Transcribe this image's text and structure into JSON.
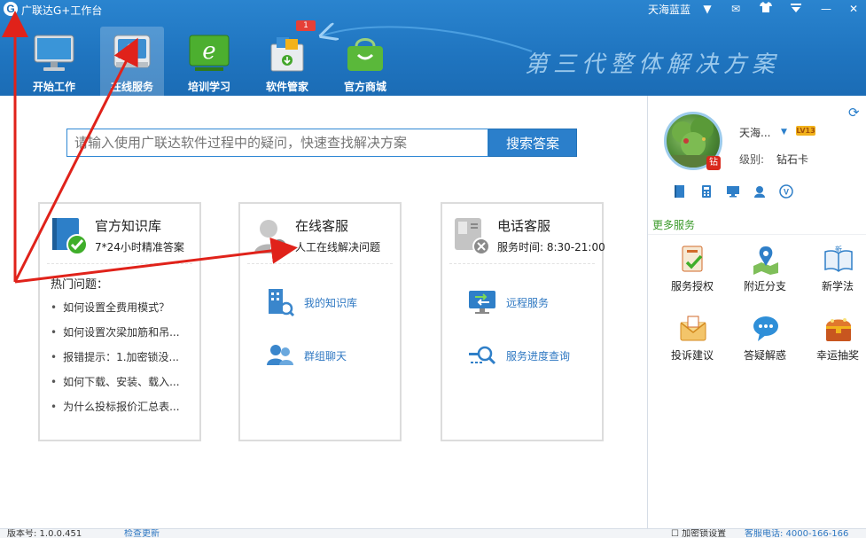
{
  "app": {
    "logo_letter": "G",
    "title": "广联达G+工作台",
    "user_name": "天海蓝蓝",
    "slogan": "第三代整体解决方案"
  },
  "nav": {
    "tabs": [
      {
        "label": "开始工作",
        "icon": "monitor-icon"
      },
      {
        "label": "在线服务",
        "icon": "glodon-service-icon",
        "active": true
      },
      {
        "label": "培训学习",
        "icon": "training-screen-icon"
      },
      {
        "label": "软件管家",
        "icon": "software-box-icon",
        "badge": "1"
      },
      {
        "label": "官方商城",
        "icon": "shopping-bag-icon"
      }
    ]
  },
  "search": {
    "placeholder": "请输入使用广联达软件过程中的疑问，快速查找解决方案",
    "button_label": "搜索答案"
  },
  "cards": {
    "knowledge": {
      "title": "官方知识库",
      "subtitle": "7*24小时精准答案",
      "hot_title": "热门问题：",
      "hot_items": [
        "如何设置全费用模式？",
        "如何设置次梁加筋和吊...",
        "报错提示：1.加密锁没...",
        "如何下载、安装、载入...",
        "为什么投标报价汇总表..."
      ]
    },
    "online": {
      "title": "在线客服",
      "subtitle": "人工在线解决问题",
      "links": [
        "我的知识库",
        "群组聊天"
      ]
    },
    "phone": {
      "title": "电话客服",
      "subtitle": "服务时间: 8:30-21:00",
      "links": [
        "远程服务",
        "服务进度查询"
      ]
    }
  },
  "sidebar": {
    "user_name": "天海...",
    "level_badge": "LV13",
    "level_label": "级别:",
    "level_value": "钻石卡",
    "avatar_badge": "钻",
    "more_services_title": "更多服务",
    "services": [
      {
        "label": "服务授权",
        "icon": "authorization-icon"
      },
      {
        "label": "附近分支",
        "icon": "map-location-icon"
      },
      {
        "label": "新学法",
        "icon": "open-book-icon"
      },
      {
        "label": "投诉建议",
        "icon": "envelope-icon"
      },
      {
        "label": "答疑解惑",
        "icon": "chat-bubble-icon"
      },
      {
        "label": "幸运抽奖",
        "icon": "treasure-chest-icon"
      }
    ]
  },
  "status_bar": {
    "version": "版本号: 1.0.0.451",
    "update": "检查更新",
    "settings": "☐ 加密锁设置",
    "phone": "客服电话: 4000-166-166"
  },
  "colors": {
    "header_blue": "#1f74bf",
    "accent_blue": "#2b7fcb",
    "link_blue": "#2f78c2",
    "annotation_red": "#e0221a",
    "more_green": "#3a9a2a"
  }
}
